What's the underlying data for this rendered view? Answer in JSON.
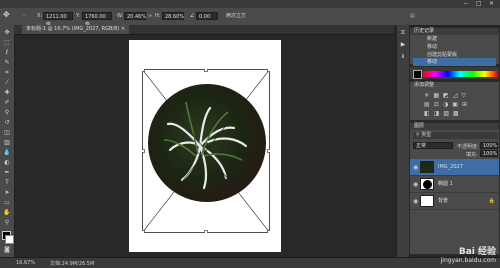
{
  "window": {
    "controls": [
      "−",
      "□",
      "✕"
    ]
  },
  "options_bar": {
    "x_value": "1211.00 像",
    "y_value": "1760.00 像",
    "w_value": "20.46%",
    "h_value": "28.60%",
    "angle_value": "0.00",
    "interp_label": "两次立方"
  },
  "document_tab": {
    "label": "未标题-1 @ 16.7% (IMG_2027, RGB/8)"
  },
  "history_panel": {
    "title": "历史记录",
    "items": [
      "新建",
      "移动",
      "创建剪贴蒙版",
      "移动"
    ],
    "selected_index": 3
  },
  "adjust_panel": {
    "title": "添加调整"
  },
  "layers_panel": {
    "tab_label": "图层",
    "blend_mode": "正常",
    "opacity": "100%",
    "fill": "100%",
    "layers": [
      {
        "name": "IMG_2027",
        "selected": true
      },
      {
        "name": "椭圆 1",
        "selected": false
      },
      {
        "name": "背景",
        "selected": false
      }
    ]
  },
  "status_bar": {
    "zoom": "16.67%",
    "doc_info": "文档:24.9M/26.5M"
  },
  "watermark": {
    "line1": "Bai 经验",
    "line2": "jingyan.baidu.com"
  },
  "colors": {
    "accent": "#3e6ea5",
    "canvas_bg": "#282828",
    "panel_bg": "#4a4a4a"
  }
}
